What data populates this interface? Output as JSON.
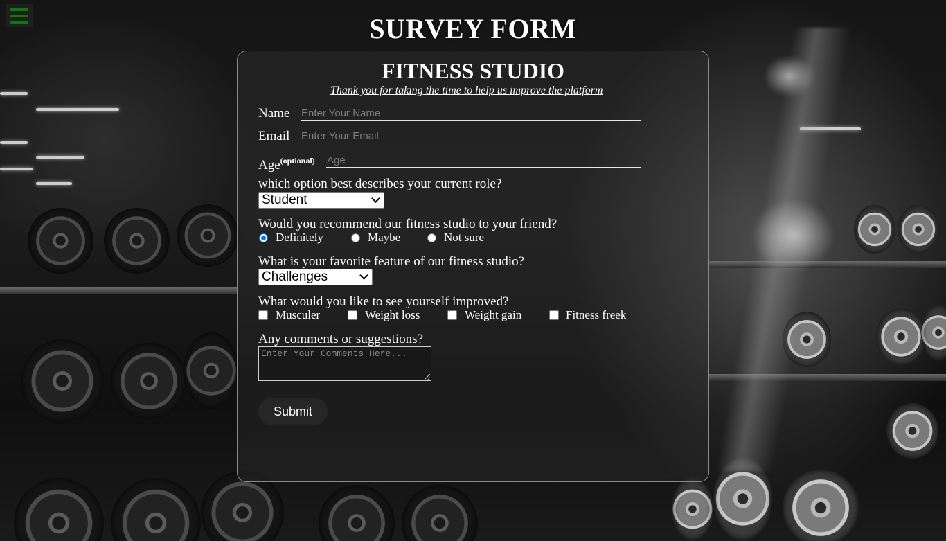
{
  "page": {
    "title": "SURVEY FORM"
  },
  "menu": {
    "icon": "hamburger-menu-icon",
    "color": "#0e7a0e"
  },
  "form": {
    "studio_title": "FITNESS STUDIO",
    "subtitle": "Thank you for taking the time to help us improve the platform",
    "name": {
      "label": "Name",
      "placeholder": "Enter Your Name",
      "value": ""
    },
    "email": {
      "label": "Email",
      "placeholder": "Enter Your Email",
      "value": ""
    },
    "age": {
      "label": "Age",
      "note": "(optional)",
      "placeholder": "Age",
      "value": ""
    },
    "role": {
      "question": "which option best describes your current role?",
      "selected": "Student"
    },
    "recommend": {
      "question": "Would you recommend our fitness studio to your friend?",
      "options": [
        {
          "label": "Definitely",
          "checked": true
        },
        {
          "label": "Maybe",
          "checked": false
        },
        {
          "label": "Not sure",
          "checked": false
        }
      ]
    },
    "feature": {
      "question": "What is your favorite feature of our fitness studio?",
      "selected": "Challenges"
    },
    "improve": {
      "question": "What would you like to see yourself improved?",
      "options": [
        {
          "label": "Musculer",
          "checked": false
        },
        {
          "label": "Weight loss",
          "checked": false
        },
        {
          "label": "Weight gain",
          "checked": false
        },
        {
          "label": "Fitness freek",
          "checked": false
        }
      ]
    },
    "comments": {
      "label": "Any comments or suggestions?",
      "placeholder": "Enter Your Comments Here...",
      "value": ""
    },
    "submit_label": "Submit"
  },
  "colors": {
    "radio_checked": "#0075ff",
    "card_border": "#8a8a8a",
    "submit_bg": "#262626"
  }
}
